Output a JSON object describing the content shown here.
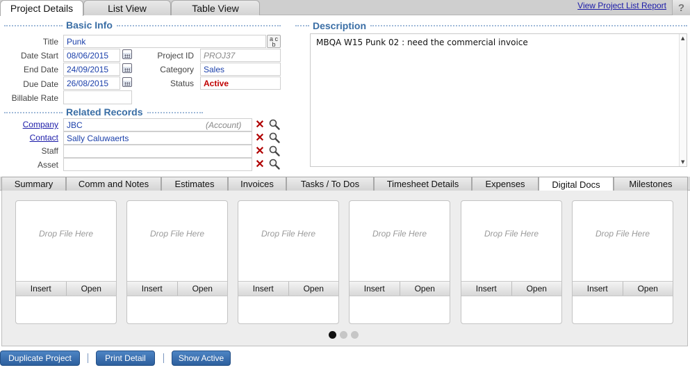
{
  "top_tabs": [
    "Project Details",
    "List View",
    "Table View"
  ],
  "report_link": "View Project List Report",
  "help_label": "?",
  "basic_info": {
    "heading": "Basic Info",
    "title_label": "Title",
    "title_value": "Punk",
    "date_start_label": "Date Start",
    "date_start_value": "08/06/2015",
    "end_date_label": "End Date",
    "end_date_value": "24/09/2015",
    "due_date_label": "Due Date",
    "due_date_value": "26/08/2015",
    "billable_rate_label": "Billable Rate",
    "billable_rate_value": "",
    "project_id_label": "Project ID",
    "project_id_value": "PROJ37",
    "category_label": "Category",
    "category_value": "Sales",
    "status_label": "Status",
    "status_value": "Active",
    "spell_icon_text_top": "a c",
    "spell_icon_text_bottom": "b"
  },
  "description": {
    "heading": "Description",
    "text": "MBQA W15 Punk 02 : need the commercial invoice"
  },
  "related_records": {
    "heading": "Related Records",
    "company_label": "Company",
    "company_value": "JBC",
    "company_hint": "(Account)",
    "contact_label": "Contact",
    "contact_value": "Sally Caluwaerts",
    "staff_label": "Staff",
    "staff_value": "",
    "asset_label": "Asset",
    "asset_value": ""
  },
  "sub_tabs": [
    "Summary",
    "Comm and Notes",
    "Estimates",
    "Invoices",
    "Tasks / To Dos",
    "Timesheet Details",
    "Expenses",
    "Digital Docs",
    "Milestones"
  ],
  "active_sub_tab": "Digital Docs",
  "doc_slots": [
    {
      "drop": "Drop File Here",
      "insert": "Insert",
      "open": "Open"
    },
    {
      "drop": "Drop File Here",
      "insert": "Insert",
      "open": "Open"
    },
    {
      "drop": "Drop File Here",
      "insert": "Insert",
      "open": "Open"
    },
    {
      "drop": "Drop File Here",
      "insert": "Insert",
      "open": "Open"
    },
    {
      "drop": "Drop File Here",
      "insert": "Insert",
      "open": "Open"
    },
    {
      "drop": "Drop File Here",
      "insert": "Insert",
      "open": "Open"
    }
  ],
  "pagination": {
    "pages": 3,
    "current": 1
  },
  "actions": {
    "duplicate": "Duplicate Project",
    "print": "Print Detail",
    "show_active": "Show Active"
  },
  "colors": {
    "accent": "#3a6ea5",
    "button": "#3a6fae",
    "status_active": "#c00000",
    "link": "#1a1aa8"
  },
  "icons": [
    "calendar-icon",
    "spell-check-icon",
    "clear-x-icon",
    "magnifier-icon",
    "help-icon"
  ]
}
